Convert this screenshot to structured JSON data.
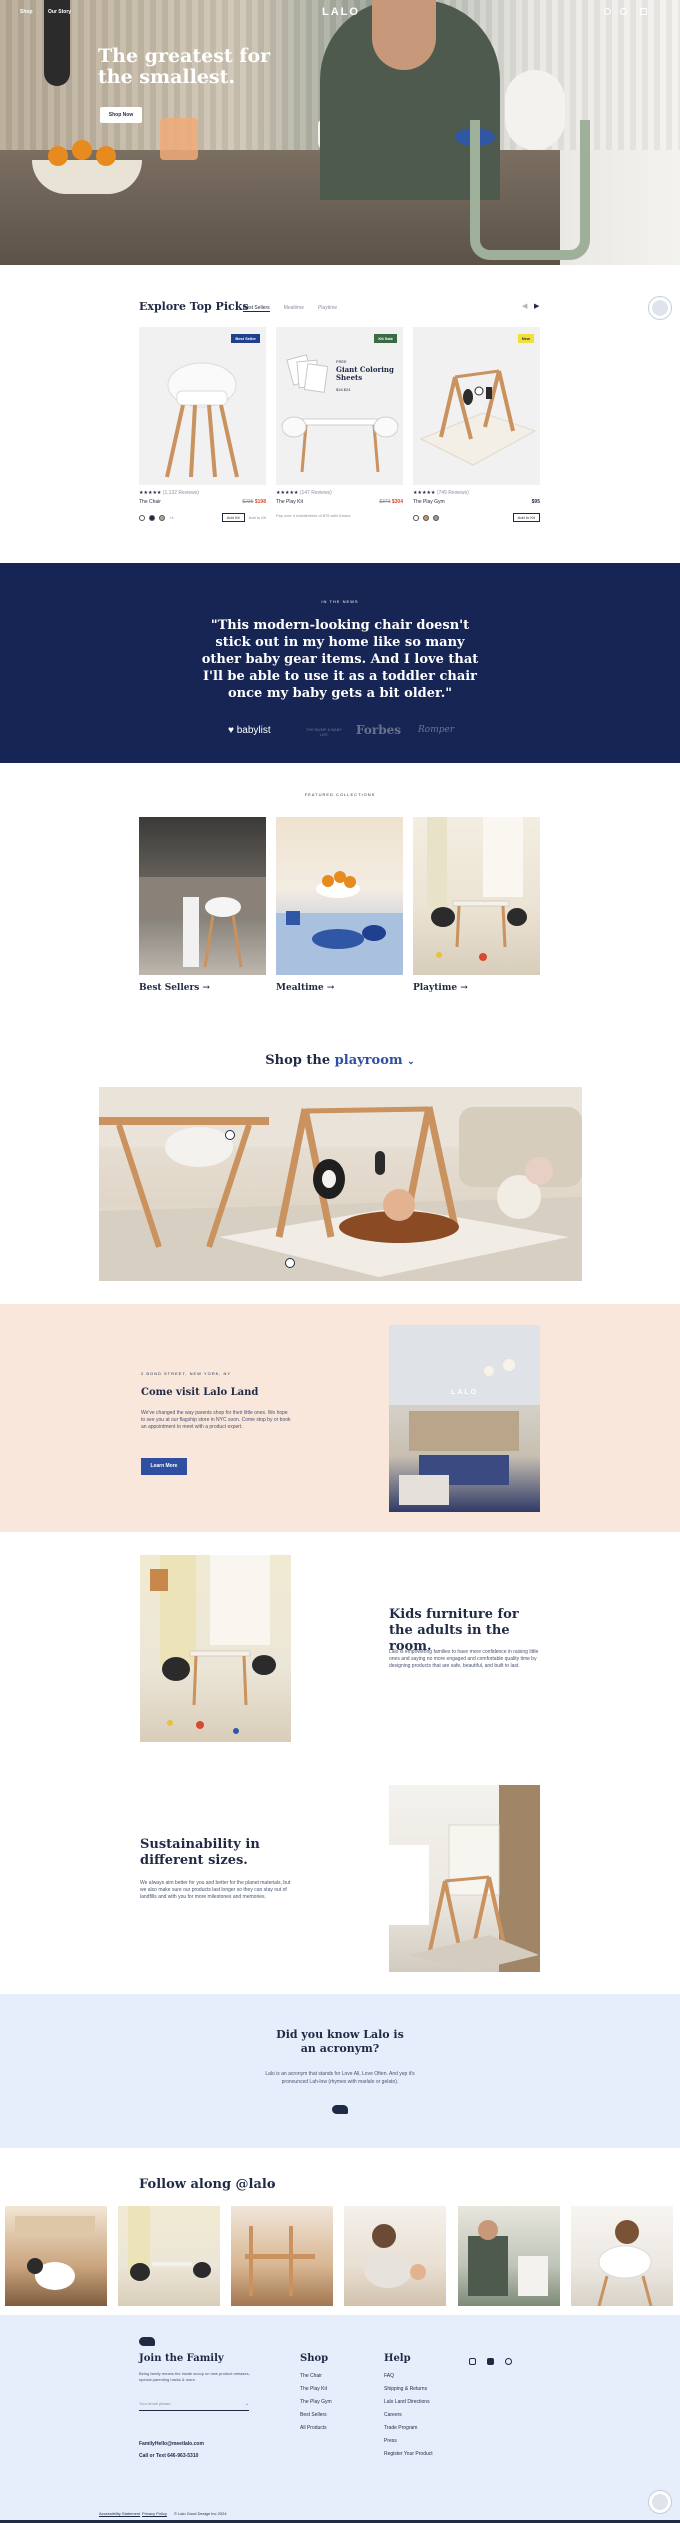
{
  "nav": {
    "shop_label": "Shop",
    "our_story_label": "Our Story",
    "logo": "LALO"
  },
  "hero": {
    "headline": "The greatest for the smallest.",
    "cta_label": "Shop Now"
  },
  "picks": {
    "title": "Explore Top Picks",
    "tabs": [
      "Best Sellers",
      "Mealtime",
      "Playtime"
    ],
    "products": [
      {
        "name": "The Chair",
        "reviews": "(1,132 Reviews)",
        "price": "$198",
        "old_price": "$235",
        "badge": "Best Seller",
        "badge_color": "#1f3f8f",
        "add_label": "Add Kit",
        "swatch_count": "+4",
        "note": ""
      },
      {
        "name": "The Play Kit",
        "reviews": "(147 Reviews)",
        "price": "$304",
        "old_price": "$373",
        "badge": "Kit Sale",
        "badge_color": "#3b6b45",
        "add_label": "",
        "swatch_count": "",
        "note": "Pay over 4 installments of $76 with Klarna",
        "overlay_title": "Giant Coloring Sheets",
        "overlay_kicker": "FREE",
        "overlay_sub": "$16 $24"
      },
      {
        "name": "The Play Gym",
        "reviews": "(749 Reviews)",
        "price": "$95",
        "old_price": "",
        "badge": "New",
        "badge_color": "#f2df38",
        "add_label": "Add to Kit",
        "swatch_count": "",
        "note": ""
      }
    ],
    "extra_label": "Add to Kit"
  },
  "press": {
    "kicker": "IN THE NEWS",
    "quote": "\"This modern-looking chair doesn't stick out in my home like so many other baby gear items. And I love that I'll be able to use it as a toddler chair once my baby gets a bit older.\"",
    "logos": [
      "♥ babylist",
      "THE BUMP & BABY LIST",
      "Forbes",
      "Romper"
    ]
  },
  "featured": {
    "kicker": "FEATURED COLLECTIONS",
    "items": [
      {
        "label": "Best Sellers →"
      },
      {
        "label": "Mealtime →"
      },
      {
        "label": "Playtime →"
      }
    ]
  },
  "shop_room": {
    "prefix": "Shop the",
    "room": "playroom",
    "chevron": "⌄"
  },
  "lalo_land": {
    "kicker": "2 BOND STREET, NEW YORK, NY",
    "title": "Come visit Lalo Land",
    "body": "We've changed the way parents shop for their little ones. We hope to see you at our flagship store in NYC soon. Come stop by or book an appointment to meet with a product expert.",
    "cta_label": "Learn More",
    "photo_sign": "LALO"
  },
  "kids": {
    "title": "Kids furniture for the adults in the room.",
    "body": "Lalo is empowering families to have more confidence in raising little ones and saying no more engaged and comfortable quality time by designing products that are safe, beautiful, and built to last."
  },
  "sustain": {
    "title": "Sustainability in different sizes.",
    "body": "We always aim better for you and better for the planet materials, but we also make sure our products last longer so they can stay out of landfills and with you for more milestones and memories."
  },
  "know": {
    "title": "Did you know Lalo is an acronym?",
    "body": "Lalo is an acronym that stands for Love All, Love Often. And yep it's pronounced Lah-low (rhymes with marlalo or gelato)."
  },
  "instagram": {
    "title": "Follow along @lalo",
    "prev": "‹",
    "next": "›"
  },
  "footer": {
    "join_title": "Join the Family",
    "join_blurb": "Being family means the inside scoop on new product releases, special parenting hacks & more.",
    "email_placeholder": "Your email please",
    "email_go": "→",
    "contact_email": "FamilyHello@meetlalo.com",
    "contact_phone": "Call or Text 646-963-5310",
    "shop_title": "Shop",
    "shop_links": [
      "The Chair",
      "The Play Kit",
      "The Play Gym",
      "Best Sellers",
      "All Products"
    ],
    "help_title": "Help",
    "help_links": [
      "FAQ",
      "Shipping & Returns",
      "Lalo Land Directions",
      "Careers",
      "Trade Program",
      "Press",
      "Register Your Product"
    ],
    "bottom_links": [
      "Accessibility Statement",
      "Privacy Policy",
      "© Lalo Good Design Inc 2024"
    ]
  },
  "colors": {
    "navy": "#172554",
    "accent_blue": "#2f4fa0",
    "peach": "#f9e7dc",
    "light_blue": "#e6eefb",
    "sale_red": "#d64a2f"
  }
}
